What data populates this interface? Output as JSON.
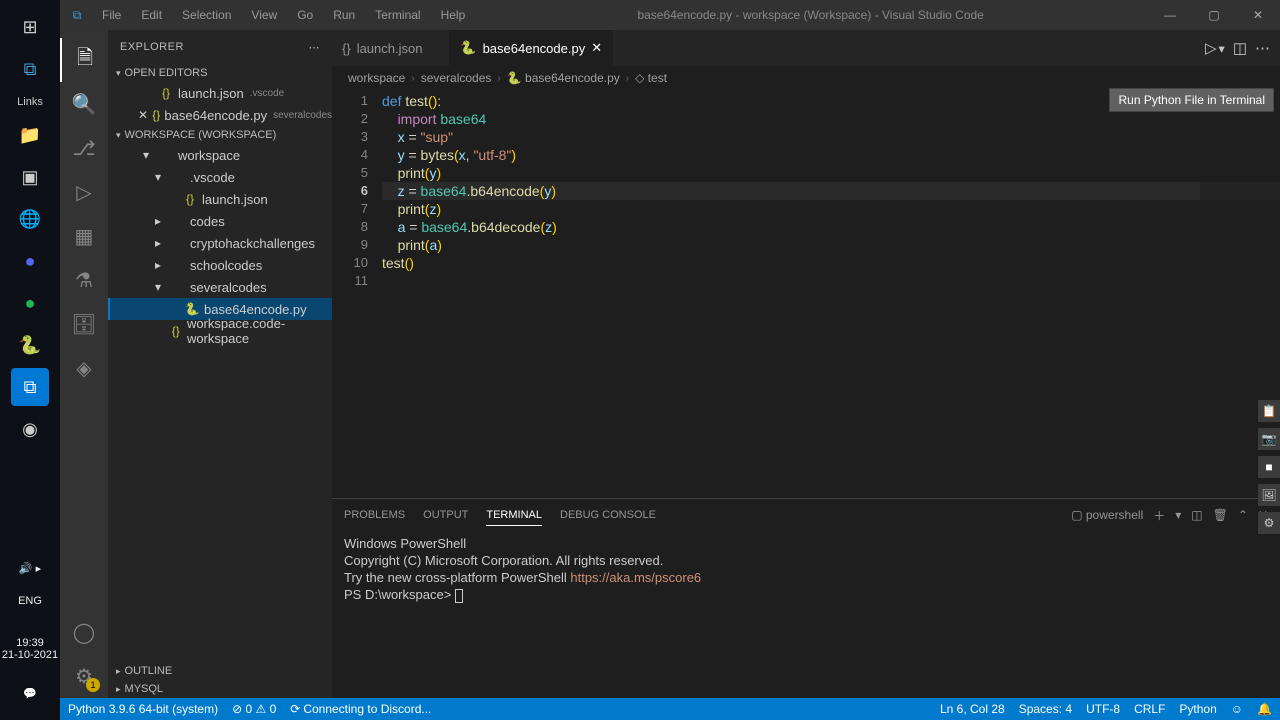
{
  "win": {
    "links": "Links",
    "lang": "ENG",
    "time": "19:39",
    "date": "21-10-2021"
  },
  "titlebar": {
    "menus": [
      "File",
      "Edit",
      "Selection",
      "View",
      "Go",
      "Run",
      "Terminal",
      "Help"
    ],
    "title": "base64encode.py - workspace (Workspace) - Visual Studio Code"
  },
  "sidebar": {
    "title": "EXPLORER",
    "openEditors": "OPEN EDITORS",
    "openItems": [
      {
        "icon": "{}",
        "name": "launch.json",
        "tag": ".vscode"
      },
      {
        "icon": "{}",
        "name": "base64encode.py",
        "tag": "severalcodes"
      }
    ],
    "wsHeader": "WORKSPACE (WORKSPACE)",
    "tree": [
      {
        "d": 1,
        "chev": "▾",
        "icon": "",
        "name": "workspace"
      },
      {
        "d": 2,
        "chev": "▾",
        "icon": "",
        "name": ".vscode"
      },
      {
        "d": 3,
        "chev": "",
        "icon": "{}",
        "name": "launch.json",
        "cls": "ico-json"
      },
      {
        "d": 2,
        "chev": "▸",
        "icon": "",
        "name": "codes"
      },
      {
        "d": 2,
        "chev": "▸",
        "icon": "",
        "name": "cryptohackchallenges"
      },
      {
        "d": 2,
        "chev": "▸",
        "icon": "",
        "name": "schoolcodes"
      },
      {
        "d": 2,
        "chev": "▾",
        "icon": "",
        "name": "severalcodes"
      },
      {
        "d": 3,
        "chev": "",
        "icon": "🐍",
        "name": "base64encode.py",
        "sel": true,
        "cls": "ico-py"
      },
      {
        "d": 2,
        "chev": "",
        "icon": "{}",
        "name": "workspace.code-workspace",
        "cls": "ico-json"
      }
    ],
    "outline": "OUTLINE",
    "mysql": "MYSQL"
  },
  "tabs": [
    {
      "icon": "{}",
      "label": "launch.json",
      "active": false
    },
    {
      "icon": "🐍",
      "label": "base64encode.py",
      "active": true
    }
  ],
  "tooltip": "Run Python File in Terminal",
  "breadcrumb": [
    "workspace",
    "severalcodes",
    "base64encode.py",
    "test"
  ],
  "code": {
    "lines": [
      1,
      2,
      3,
      4,
      5,
      6,
      7,
      8,
      9,
      10,
      11
    ],
    "current": 6
  },
  "panel": {
    "tabs": [
      "PROBLEMS",
      "OUTPUT",
      "TERMINAL",
      "DEBUG CONSOLE"
    ],
    "active": "TERMINAL",
    "shell": "powershell",
    "lines": [
      "Windows PowerShell",
      "Copyright (C) Microsoft Corporation. All rights reserved.",
      "",
      "Try the new cross-platform PowerShell https://aka.ms/pscore6",
      "",
      "PS D:\\workspace> "
    ]
  },
  "status": {
    "py": "Python 3.9.6 64-bit (system)",
    "errs": "⊘ 0 ⚠ 0",
    "discord": "Connecting to Discord...",
    "pos": "Ln 6, Col 28",
    "spaces": "Spaces: 4",
    "enc": "UTF-8",
    "eol": "CRLF",
    "lang": "Python"
  }
}
